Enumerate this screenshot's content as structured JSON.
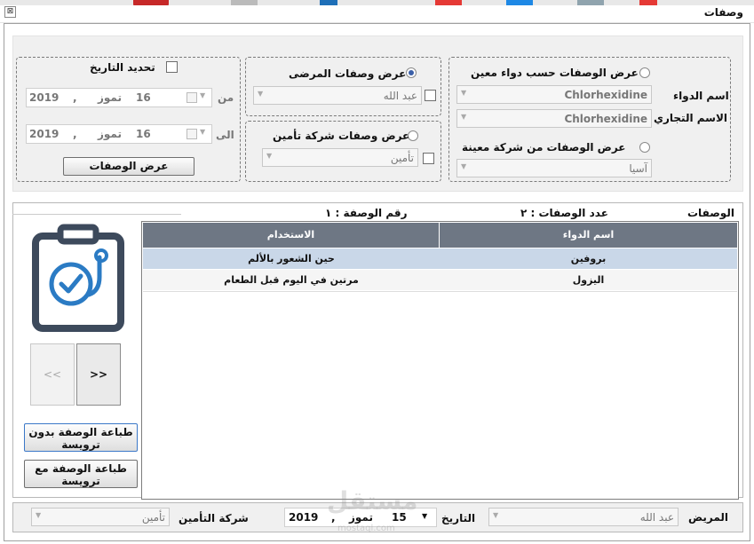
{
  "window": {
    "title": "وصفات",
    "close_glyph": "⊠"
  },
  "filters": {
    "date": {
      "check_label": "تحديد التاريخ",
      "from_label": "من",
      "to_label": "الى",
      "from": {
        "day": "16",
        "month": "تموز",
        "sep": ",",
        "year": "2019"
      },
      "to": {
        "day": "16",
        "month": "تموز",
        "sep": ",",
        "year": "2019"
      },
      "show_button": "عرض الوصفات"
    },
    "patient": {
      "radio_label": "عرض وصفات المرضى",
      "combo_value": "عبد الله",
      "selected": true
    },
    "insurance": {
      "radio_label": "عرض وصفات شركة تأمين",
      "combo_value": "تأمين",
      "selected": false
    },
    "drug": {
      "radio_label": "عرض الوصفات حسب دواء معين",
      "drug_name_label": "اسم الدواء",
      "drug_name_value": "Chlorhexidine",
      "trade_name_label": "الاسم التجاري",
      "trade_name_value": "Chlorhexidine",
      "company_radio_label": "عرض الوصفات من شركة معينة",
      "company_value": "آسيا",
      "selected": false
    }
  },
  "info": {
    "section_label": "الوصفات",
    "count_text": "عدد الوصفات : ٢",
    "number_text": "رقم الوصفة : ١"
  },
  "table": {
    "columns": [
      "اسم الدواء",
      "الاستخدام"
    ],
    "rows": [
      {
        "drug": "بروفين",
        "usage": "حين الشعور بالألم"
      },
      {
        "drug": "اليزول",
        "usage": "مرتين في اليوم  قبل الطعام"
      }
    ]
  },
  "nav": {
    "next": ">>",
    "prev": "<<"
  },
  "actions": {
    "print_without_header": "طباعة الوصفة بدون ترويسة",
    "print_with_header": "طباعة الوصفة مع ترويسة"
  },
  "footer": {
    "patient_label": "المريض",
    "patient_value": "عبد الله",
    "date_label": "التاريخ",
    "date": {
      "day": "15",
      "month": "تموز",
      "sep": ",",
      "year": "2019"
    },
    "insurance_label": "شركة التأمين",
    "insurance_value": "تأمين"
  },
  "watermark": {
    "text": "مستقل",
    "sub": "mostaql.com"
  },
  "colors": {
    "accent_blue": "#2b7bc4",
    "icon_dark": "#3d4a5c",
    "header_gray": "#6e7784",
    "selection": "#c9d7e8"
  }
}
